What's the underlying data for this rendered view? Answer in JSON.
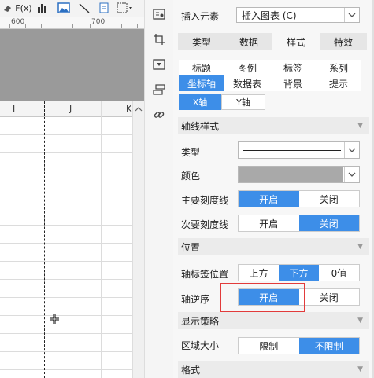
{
  "toolbar": {
    "items": [
      {
        "name": "eraser-icon",
        "label": "⌫"
      },
      {
        "name": "formula-icon",
        "label": "F(x)"
      },
      {
        "name": "bar-chart-icon",
        "label": ""
      },
      {
        "name": "image-icon",
        "label": ""
      },
      {
        "name": "line-icon",
        "label": ""
      },
      {
        "name": "document-icon",
        "label": ""
      },
      {
        "name": "border-icon",
        "label": ""
      }
    ]
  },
  "ruler": {
    "labels": [
      "600",
      "700"
    ]
  },
  "grid": {
    "columns": [
      "I",
      "J",
      "K"
    ]
  },
  "sidebar_icons": [
    "chart-properties-icon",
    "crop-icon",
    "dropdown-widget-icon",
    "layers-icon",
    "link-icon"
  ],
  "panel": {
    "insert_label": "插入元素",
    "insert_value": "插入图表 (C)",
    "tabs": [
      "类型",
      "数据",
      "样式",
      "特效"
    ],
    "active_tab": "样式",
    "subtabs_row1": [
      "标题",
      "图例",
      "标签",
      "系列"
    ],
    "subtabs_row2": [
      "坐标轴",
      "数据表",
      "背景",
      "提示"
    ],
    "active_subtab": "坐标轴",
    "axis_tabs": [
      "X轴",
      "Y轴"
    ],
    "active_axis": "X轴",
    "sections": {
      "axis_style": "轴线样式",
      "position": "位置",
      "display_strategy": "显示策略",
      "format": "格式"
    },
    "fields": {
      "type_label": "类型",
      "color_label": "颜色",
      "color_value": "#a9a9a9",
      "major_tick_label": "主要刻度线",
      "minor_tick_label": "次要刻度线",
      "label_position_label": "轴标签位置",
      "reverse_label": "轴逆序",
      "area_size_label": "区域大小"
    },
    "options": {
      "on": "开启",
      "off": "关闭",
      "above": "上方",
      "below": "下方",
      "zero": "0值",
      "limit": "限制",
      "no_limit": "不限制"
    },
    "accent": "#3d8ee8"
  }
}
